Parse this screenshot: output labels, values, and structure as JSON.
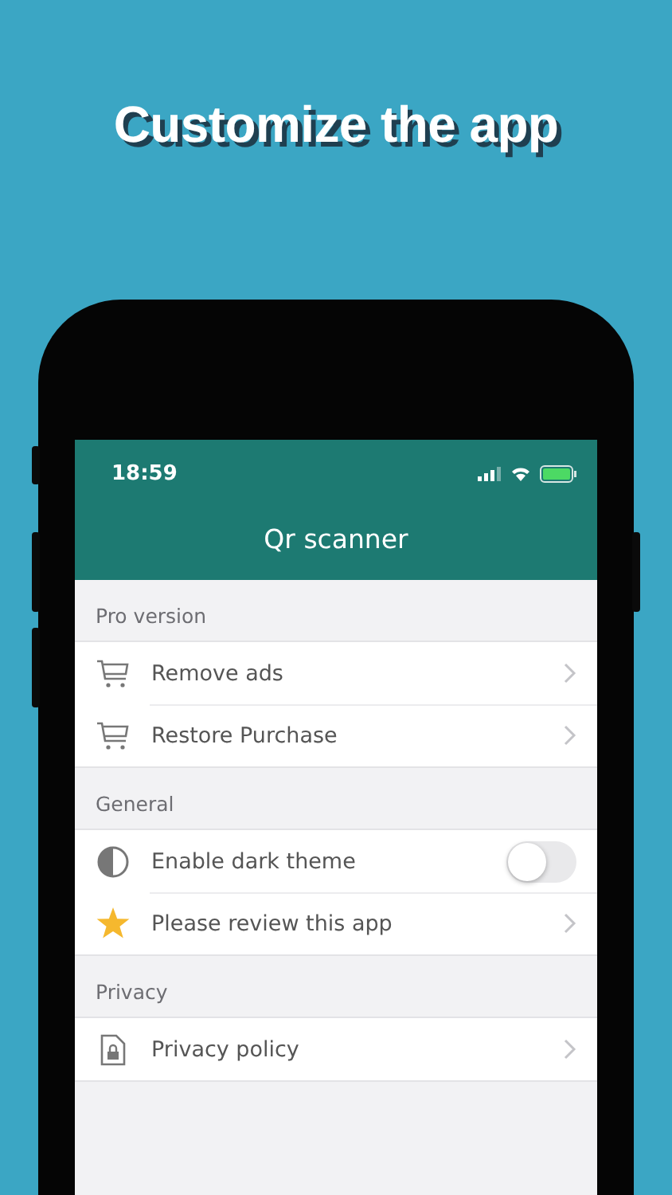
{
  "headline": "Customize the app",
  "status_bar": {
    "time": "18:59"
  },
  "nav": {
    "title": "Qr scanner"
  },
  "sections": [
    {
      "title": "Pro version",
      "items": [
        {
          "kind": "link",
          "label": "Remove ads"
        },
        {
          "kind": "link",
          "label": "Restore Purchase"
        }
      ]
    },
    {
      "title": "General",
      "items": [
        {
          "kind": "toggle",
          "label": "Enable dark theme",
          "on": false
        },
        {
          "kind": "link",
          "label": "Please review this app"
        }
      ]
    },
    {
      "title": "Privacy",
      "items": [
        {
          "kind": "link",
          "label": "Privacy policy"
        }
      ]
    }
  ]
}
